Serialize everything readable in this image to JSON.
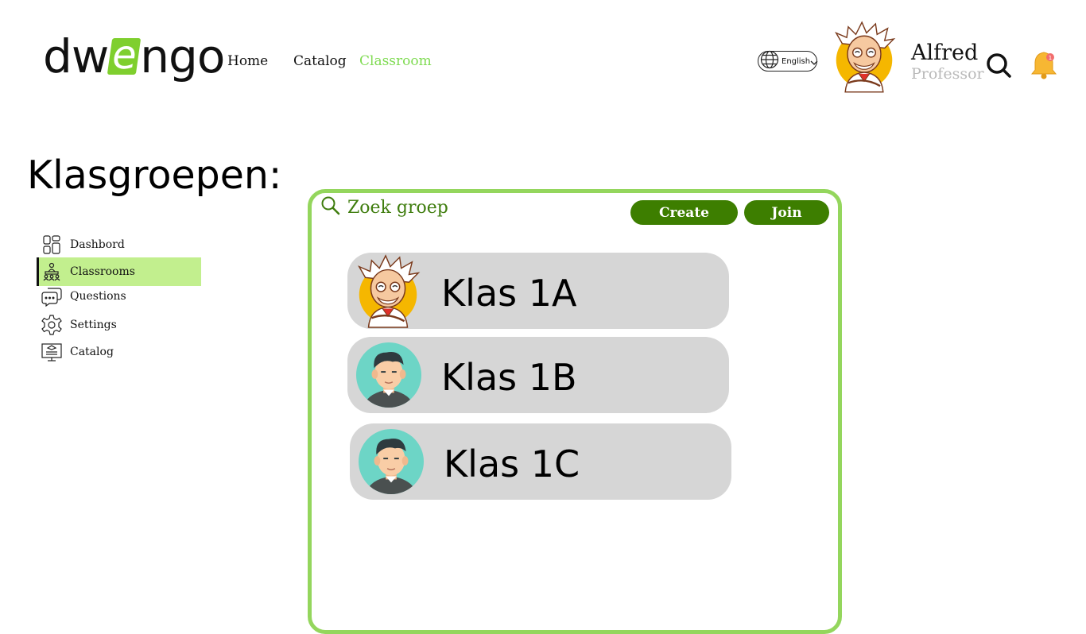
{
  "header": {
    "logo_left": "dw",
    "logo_e": "e",
    "logo_right": "ngo",
    "nav": [
      {
        "label": "Home"
      },
      {
        "label": "Catalog"
      },
      {
        "label": "Classroom"
      }
    ],
    "language": "English",
    "user": {
      "name": "Alfred",
      "role": "Professor"
    },
    "notification_count": "1"
  },
  "page_title": "Klasgroepen:",
  "sidebar": {
    "items": [
      {
        "label": "Dashbord",
        "icon": "dashboard-icon"
      },
      {
        "label": "Classrooms",
        "icon": "classroom-icon"
      },
      {
        "label": "Questions",
        "icon": "questions-icon"
      },
      {
        "label": "Settings",
        "icon": "gear-icon"
      },
      {
        "label": "Catalog",
        "icon": "catalog-icon"
      }
    ]
  },
  "main": {
    "search_placeholder": "Zoek groep",
    "create_label": "Create",
    "join_label": "Join",
    "classes": [
      {
        "name": "Klas 1A",
        "avatar": "professor-avatar"
      },
      {
        "name": "Klas 1B",
        "avatar": "student-avatar"
      },
      {
        "name": "Klas 1C",
        "avatar": "student-avatar"
      }
    ]
  },
  "colors": {
    "accent": "#7fdb52",
    "active_sidebar": "#c2ef8e",
    "panel_border": "#94d65d",
    "button": "#3d7e00",
    "card": "#d6d6d6"
  }
}
